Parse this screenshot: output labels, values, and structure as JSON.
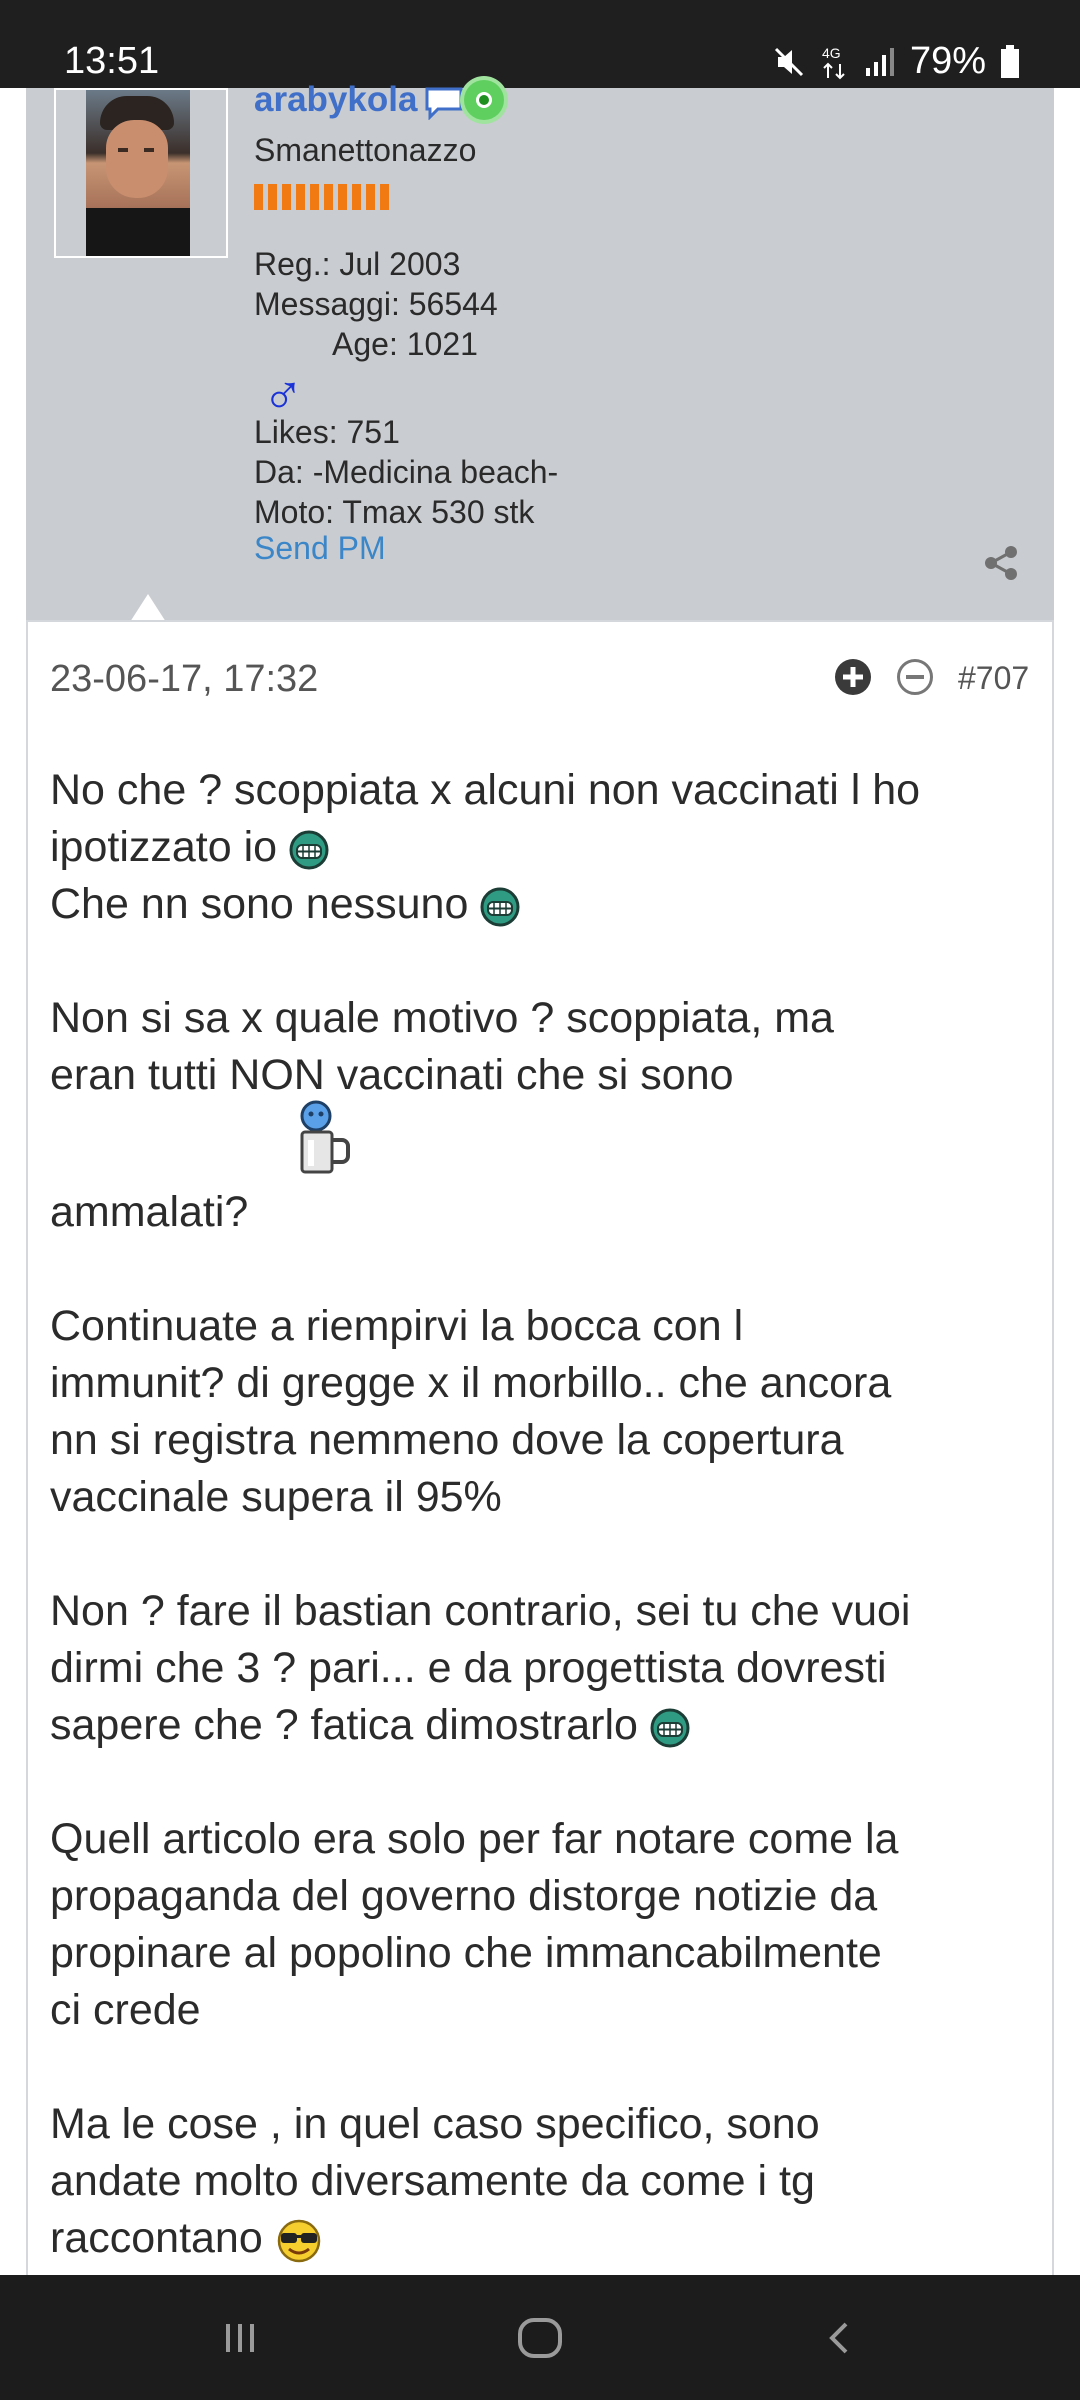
{
  "status_bar": {
    "time": "13:51",
    "network": "4G",
    "battery": "79%",
    "icons": [
      "mute-icon",
      "network-4g-icon",
      "signal-icon",
      "battery-icon"
    ]
  },
  "profile": {
    "username": "arabykola",
    "title": "Smanettonazzo",
    "reg": "Reg.: Jul 2003",
    "messages": "Messaggi: 56544",
    "age": "Age: 1021",
    "gender_symbol": "♂",
    "likes": "Likes: 751",
    "from": "Da: -Medicina beach-",
    "moto": "Moto: Tmax 530 stk",
    "send_pm": "Send PM",
    "reputation_segments": 10,
    "colors": {
      "username": "#3f6fc8",
      "link": "#3a86c8",
      "reputation": "#f27a12",
      "background": "#c9ccd0"
    }
  },
  "post": {
    "date": "23-06-17, 17:32",
    "number": "#707",
    "paragraphs": {
      "p1a": "No che ? scoppiata x alcuni non vaccinati l ho",
      "p1b": "ipotizzato io",
      "p1c": "Che nn sono nessuno",
      "p2a": "Non si sa x quale motivo ? scoppiata, ma",
      "p2b": "eran tutti NON vaccinati che si sono",
      "p2c": "ammalati?",
      "p3a": "Continuate a riempirvi la bocca con l",
      "p3b": "immunit? di gregge x il morbillo.. che ancora",
      "p3c": "nn si registra nemmeno dove la copertura",
      "p3d": "vaccinale supera il 95%",
      "p4a": "Non ? fare il bastian contrario, sei tu che vuoi",
      "p4b": "dirmi che 3 ? pari... e da progettista dovresti",
      "p4c": "sapere che ? fatica dimostrarlo",
      "p5a": "Quell articolo era solo per far notare come la",
      "p5b": "propaganda del governo distorge notizie da",
      "p5c": "propinare al popolino che immancabilmente",
      "p5d": "ci crede",
      "p6a": "Ma le cose , in quel caso specifico, sono",
      "p6b": "andate molto diversamente da come i tg",
      "p6c": "raccontano"
    }
  },
  "nav_bar": {
    "buttons": [
      "recent-apps",
      "home",
      "back"
    ]
  }
}
